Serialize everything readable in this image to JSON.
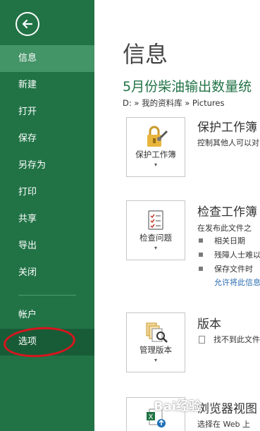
{
  "sidebar": {
    "items": [
      {
        "label": "信息",
        "state": "active"
      },
      {
        "label": "新建"
      },
      {
        "label": "打开"
      },
      {
        "label": "保存"
      },
      {
        "label": "另存为"
      },
      {
        "label": "打印"
      },
      {
        "label": "共享"
      },
      {
        "label": "导出"
      },
      {
        "label": "关闭"
      }
    ],
    "bottom_items": [
      {
        "label": "帐户"
      },
      {
        "label": "选项",
        "state": "hover"
      }
    ],
    "colors": {
      "background": "#217346",
      "active": "#439467",
      "hover": "#185c37"
    }
  },
  "main": {
    "title": "信息",
    "doc_title": "5月份柴油输出数量统",
    "doc_path": "D: » 我的资料库 » Pictures",
    "protect": {
      "button_label": "保护工作簿",
      "icon": "lock-icon",
      "title": "保护工作簿",
      "desc": "控制其他人可以对"
    },
    "inspect": {
      "button_label": "检查问题",
      "icon": "checklist-icon",
      "title": "检查工作簿",
      "desc": "在发布此文件之",
      "bullets": [
        "相关日期",
        "残障人士难以",
        "保存文件时"
      ],
      "link": "允许将此信息"
    },
    "versions": {
      "button_label": "管理版本",
      "icon": "versions-icon",
      "title": "版本",
      "desc": "找不到此文件"
    },
    "browser": {
      "icon": "excel-web-icon",
      "title": "浏览器视图",
      "desc": "选择在 Web 上"
    },
    "accent": "#217346",
    "link_color": "#2b6cb0"
  },
  "watermark": "Bai经验"
}
